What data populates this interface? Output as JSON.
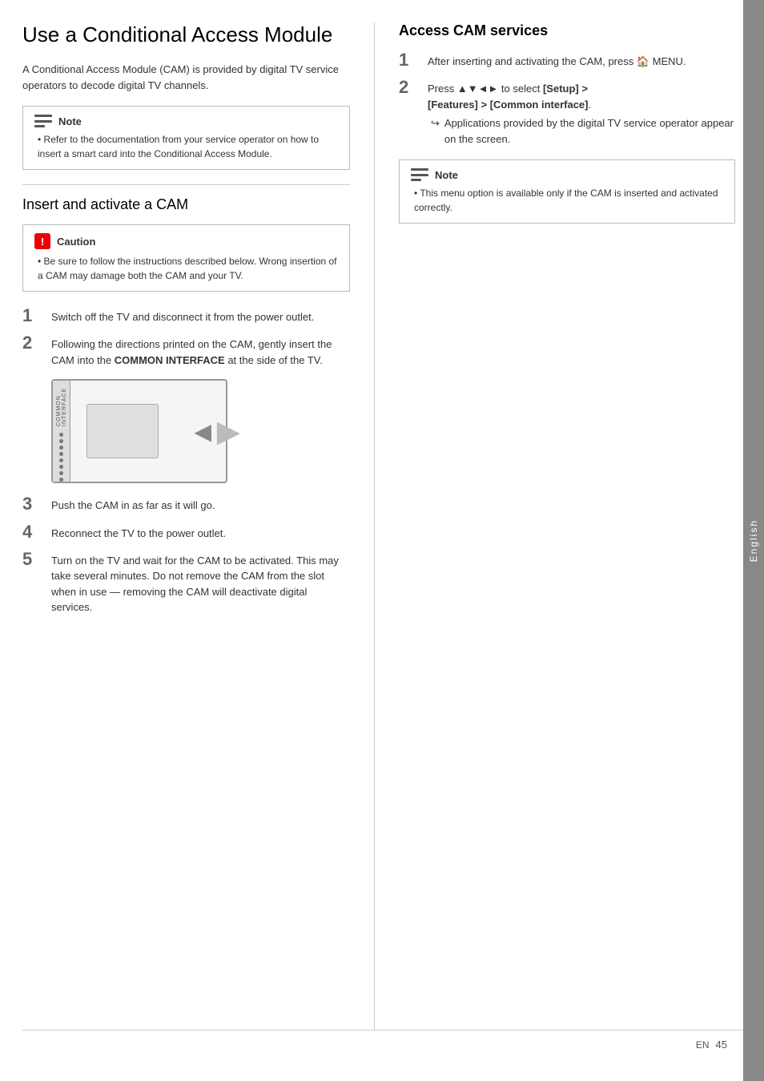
{
  "page": {
    "number": "45",
    "lang": "EN"
  },
  "sidebar": {
    "label": "English"
  },
  "main_title": "Use a Conditional Access Module",
  "intro_text": "A Conditional Access Module (CAM) is provided by digital TV service operators to decode digital TV channels.",
  "note1": {
    "label": "Note",
    "items": [
      "Refer to the documentation from your service operator on how to insert a smart card into the Conditional Access Module."
    ]
  },
  "section_insert": {
    "title": "Insert and activate a CAM",
    "caution": {
      "label": "Caution",
      "items": [
        "Be sure to follow the instructions described below. Wrong insertion of a CAM may damage both the CAM and your TV."
      ]
    },
    "steps": [
      {
        "num": "1",
        "text": "Switch off the TV and disconnect it from the power outlet."
      },
      {
        "num": "2",
        "text": "Following the directions printed on the CAM, gently insert the CAM into the COMMON INTERFACE at the side of the TV.",
        "bold_words": [
          "COMMON INTERFACE"
        ]
      },
      {
        "num": "3",
        "text": "Push the CAM in as far as it will go."
      },
      {
        "num": "4",
        "text": "Reconnect the TV to the power outlet."
      },
      {
        "num": "5",
        "text": "Turn on the TV and wait for the CAM to be activated. This may take several minutes. Do not remove the CAM from the slot when in use — removing the CAM will deactivate digital services."
      }
    ],
    "diagram": {
      "label": "COMMON INTERFACE",
      "dots_count": 8
    }
  },
  "section_access": {
    "title": "Access CAM services",
    "steps": [
      {
        "num": "1",
        "text": "After inserting and activating the CAM, press",
        "icon": "🏠",
        "icon_label": "home",
        "after_icon": "MENU."
      },
      {
        "num": "2",
        "text": "Press ▲▼◄► to select",
        "bold_part": "[Setup] > [Features] > [Common interface]",
        "sub_bullet": "Applications provided by the digital TV service operator appear on the screen."
      }
    ],
    "note": {
      "label": "Note",
      "items": [
        "This menu option is available only if the CAM is inserted and activated correctly."
      ]
    }
  }
}
